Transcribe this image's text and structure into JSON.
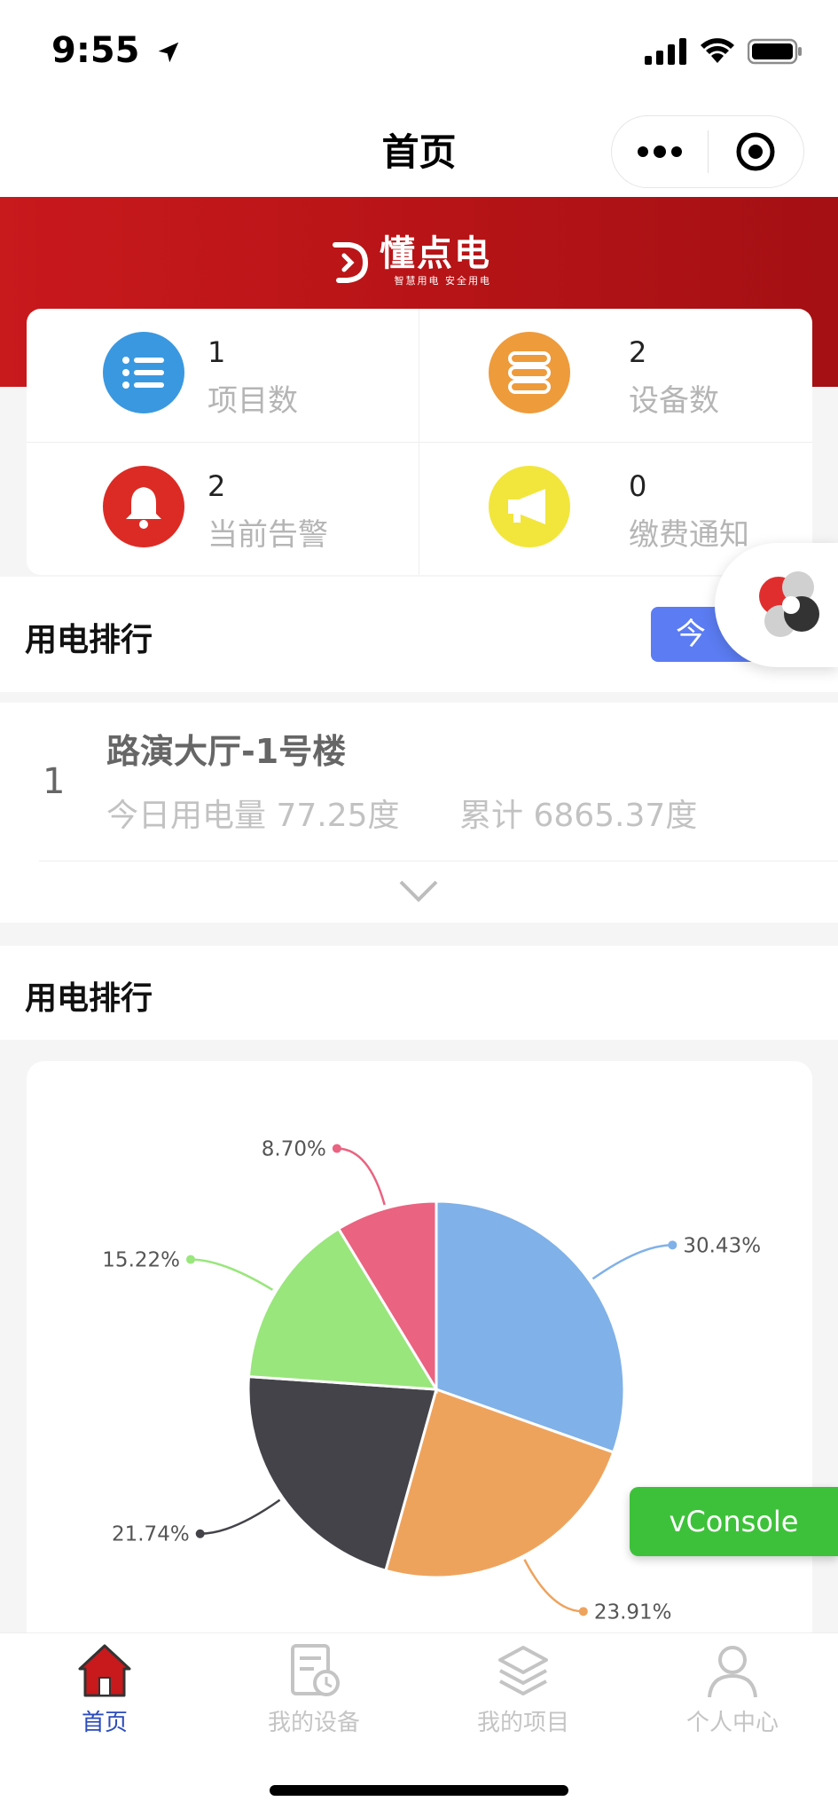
{
  "status_bar": {
    "time": "9:55"
  },
  "nav": {
    "title": "首页"
  },
  "banner": {
    "logo_name": "懂点电",
    "logo_tagline": "智慧用电 安全用电"
  },
  "stats": [
    {
      "value": "1",
      "label": "项目数",
      "icon": "list-icon",
      "color": "#3a98e0"
    },
    {
      "value": "2",
      "label": "设备数",
      "icon": "server-icon",
      "color": "#ee9b3c"
    },
    {
      "value": "2",
      "label": "当前告警",
      "icon": "bell-icon",
      "color": "#dc2b25"
    },
    {
      "value": "0",
      "label": "缴费通知",
      "icon": "megaphone-icon",
      "color": "#f2e63c"
    }
  ],
  "ranking": {
    "title": "用电排行",
    "filter_label": "今",
    "items": [
      {
        "rank": "1",
        "name": "路演大厅-1号楼",
        "today": "今日用电量 77.25度",
        "total": "累计 6865.37度"
      }
    ]
  },
  "chart_section": {
    "title": "用电排行"
  },
  "chart_data": {
    "type": "pie",
    "values": [
      30.43,
      23.91,
      21.74,
      15.22,
      8.7
    ],
    "labels": [
      "30.43%",
      "23.91%",
      "21.74%",
      "15.22%",
      "8.70%"
    ],
    "colors": [
      "#80b1e8",
      "#eea35d",
      "#434349",
      "#99e67c",
      "#ea6381"
    ]
  },
  "vconsole": {
    "label": "vConsole"
  },
  "tabs": [
    {
      "label": "首页",
      "active": true
    },
    {
      "label": "我的设备",
      "active": false
    },
    {
      "label": "我的项目",
      "active": false
    },
    {
      "label": "个人中心",
      "active": false
    }
  ],
  "colors": {
    "brand_red": "#c8191d",
    "accent_blue": "#5b7cf2",
    "active_tab": "#2b4bbd",
    "vconsole_green": "#3ec13a"
  }
}
